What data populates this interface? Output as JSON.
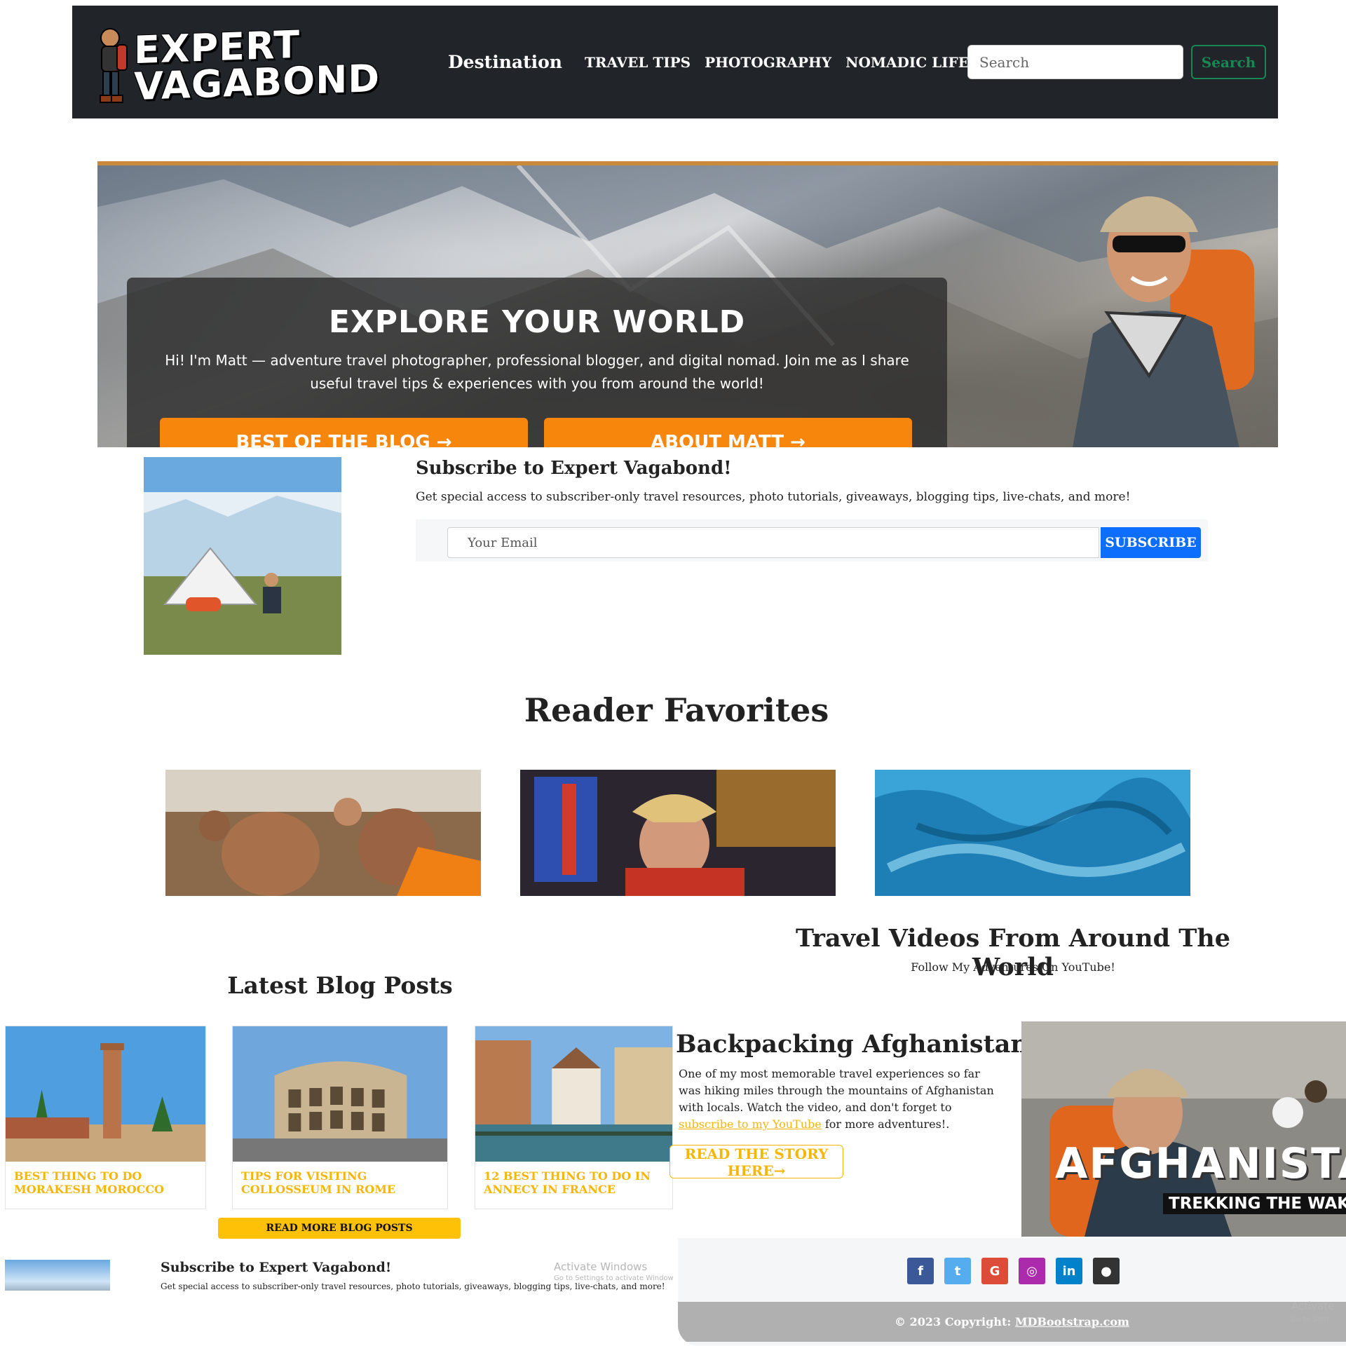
{
  "brand": {
    "logo_line1": "EXPERT",
    "logo_line2": "VAGABOND"
  },
  "nav": {
    "destination": "Destination",
    "travel_tips": "TRAVEL TIPS",
    "photography": "PHOTOGRAPHY",
    "nomadic_life": "NOMADIC LIFE",
    "search_placeholder": "Search",
    "search_button": "Search"
  },
  "hero": {
    "title": "EXPLORE YOUR WORLD",
    "text": "Hi! I'm Matt — adventure travel photographer, professional blogger, and digital nomad. Join me as I share useful travel tips & experiences with you from around the world!",
    "button_blog": "BEST OF THE BLOG →",
    "button_about": "ABOUT MATT →"
  },
  "subscribe": {
    "title": "Subscribe to Expert Vagabond!",
    "description": "Get special access to subscriber-only travel resources, photo tutorials, giveaways, blogging tips, live-chats, and more!",
    "email_placeholder": "Your Email",
    "button": "SUBSCRIBE"
  },
  "favorites": {
    "heading": "Reader Favorites"
  },
  "videos": {
    "title": "Travel Videos From Around The World",
    "subtitle": "Follow My Adventures On YouTube!"
  },
  "blog": {
    "heading": "Latest Blog Posts",
    "posts": [
      {
        "title": "BEST THING TO DO MORAKESH MOROCCO"
      },
      {
        "title": "TIPS FOR VISITING COLLOSSEUM IN ROME"
      },
      {
        "title": "12 BEST THING TO DO IN ANNECY IN FRANCE"
      }
    ],
    "read_more": "READ MORE BLOG POSTS"
  },
  "subscribe_bottom": {
    "title": "Subscribe to Expert Vagabond!",
    "description": "Get special access to subscriber-only travel resources, photo tutorials, giveaways, blogging tips, live-chats, and more!"
  },
  "afghanistan": {
    "title": "Backpacking Afghanistan",
    "text_before": "One of my most memorable travel experiences so far was hiking miles through the mountains of Afghanistan with locals. Watch the video, and don't forget to ",
    "link": "subscribe to my YouTube",
    "text_after": " for more adventures!.",
    "button": "READ THE STORY HERE→",
    "image_title": "AFGHANISTAN",
    "image_subtitle": "TREKKING THE WAKHAN"
  },
  "footer": {
    "social": [
      {
        "icon": "facebook-icon",
        "glyph": "f",
        "color": "#3b5998"
      },
      {
        "icon": "twitter-icon",
        "glyph": "t",
        "color": "#55acee"
      },
      {
        "icon": "google-icon",
        "glyph": "G",
        "color": "#dd4b39"
      },
      {
        "icon": "instagram-icon",
        "glyph": "◎",
        "color": "#ac2bac"
      },
      {
        "icon": "linkedin-icon",
        "glyph": "in",
        "color": "#0082ca"
      },
      {
        "icon": "github-icon",
        "glyph": "●",
        "color": "#333333"
      }
    ],
    "copyright": "© 2023 Copyright: ",
    "copyright_link": "MDBootstrap.com"
  },
  "watermark": {
    "activate": "Activate Windows",
    "settings": "Go to Settings to activate Windows.",
    "activate_short": "Activate",
    "settings_short": "Go to Setti"
  }
}
